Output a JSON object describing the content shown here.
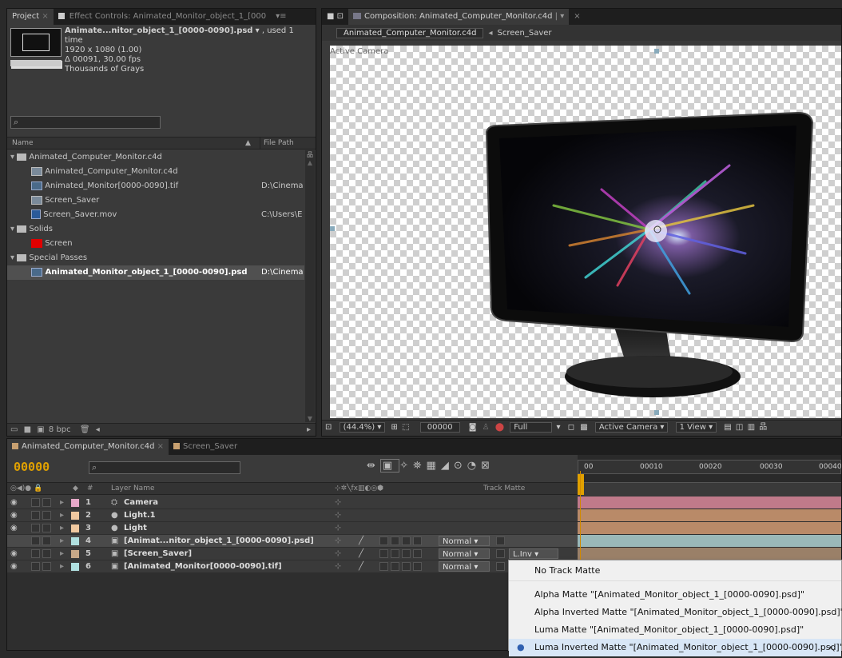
{
  "project_panel": {
    "tabs": [
      "Project",
      "Effect Controls: Animated_Monitor_object_1_[000",
      "▾≡"
    ],
    "footage": {
      "name": "Animate...nitor_object_1_[0000-0090].psd",
      "usage": ", used 1 time",
      "resolution": "1920 x 1080 (1.00)",
      "duration": "Δ 00091, 30.00 fps",
      "color": "Thousands of Grays"
    },
    "search_placeholder": "",
    "columns": {
      "name": "Name",
      "path": "File Path"
    },
    "items": [
      {
        "label": "Animated_Computer_Monitor.c4d",
        "path": "",
        "type": "folder",
        "indent": 0
      },
      {
        "label": "Animated_Computer_Monitor.c4d",
        "path": "",
        "type": "comp",
        "indent": 1
      },
      {
        "label": "Animated_Monitor[0000-0090].tif",
        "path": "D:\\Cinema",
        "type": "footage",
        "indent": 1
      },
      {
        "label": "Screen_Saver",
        "path": "",
        "type": "comp",
        "indent": 1
      },
      {
        "label": "Screen_Saver.mov",
        "path": "C:\\Users\\E",
        "type": "movie",
        "indent": 1
      },
      {
        "label": "Solids",
        "path": "",
        "type": "folder",
        "indent": 0
      },
      {
        "label": "Screen",
        "path": "",
        "type": "solid",
        "indent": 1
      },
      {
        "label": "Special Passes",
        "path": "",
        "type": "folder",
        "indent": 0
      },
      {
        "label": "Animated_Monitor_object_1_[0000-0090].psd",
        "path": "D:\\Cinema",
        "type": "footage",
        "indent": 1,
        "selected": true
      }
    ],
    "bpc": "8 bpc"
  },
  "composition_panel": {
    "tab": "Composition: Animated_Computer_Monitor.c4d",
    "breadcrumbs": [
      "Animated_Computer_Monitor.c4d",
      "Screen_Saver"
    ],
    "active_camera_label": "Active Camera",
    "toolbar": {
      "zoom": "(44.4%)",
      "timecode": "00000",
      "resolution": "Full",
      "camera": "Active Camera",
      "views": "1 View"
    }
  },
  "timeline": {
    "tabs": [
      "Animated_Computer_Monitor.c4d",
      "Screen_Saver"
    ],
    "timecode": "00000",
    "columns": {
      "layer_name": "Layer Name",
      "track_matte": "Track Matte",
      "num": "#"
    },
    "ruler": [
      "00010",
      "00020",
      "00030",
      "00040"
    ],
    "layers": [
      {
        "num": "1",
        "name": "Camera",
        "color": "#e6a8c8",
        "mode": "",
        "matte": "",
        "bar": "#c07a8a"
      },
      {
        "num": "2",
        "name": "Light.1",
        "color": "#f0c8a0",
        "mode": "",
        "matte": "",
        "bar": "#b98a68"
      },
      {
        "num": "3",
        "name": "Light",
        "color": "#f0c8a0",
        "mode": "",
        "matte": "",
        "bar": "#b98a68"
      },
      {
        "num": "4",
        "name": "[Animat...nitor_object_1_[0000-0090].psd]",
        "color": "#b0e0e0",
        "mode": "Normal",
        "matte": "",
        "bar": "#9ab8b8"
      },
      {
        "num": "5",
        "name": "[Screen_Saver]",
        "color": "#c8a888",
        "mode": "Normal",
        "matte": "L.Inv",
        "bar": "#9a8068"
      },
      {
        "num": "6",
        "name": "[Animated_Monitor[0000-0090].tif]",
        "color": "#b0e0e0",
        "mode": "Normal",
        "matte": "",
        "bar": "#6a8080"
      }
    ]
  },
  "track_matte_menu": {
    "items": [
      {
        "label": "No Track Matte",
        "checked": false
      },
      {
        "label": "Alpha Matte \"[Animated_Monitor_object_1_[0000-0090].psd]\"",
        "checked": false
      },
      {
        "label": "Alpha Inverted Matte \"[Animated_Monitor_object_1_[0000-0090].psd]\"",
        "checked": false
      },
      {
        "label": "Luma Matte \"[Animated_Monitor_object_1_[0000-0090].psd]\"",
        "checked": false
      },
      {
        "label": "Luma Inverted Matte \"[Animated_Monitor_object_1_[0000-0090].psd]\"",
        "checked": true
      }
    ]
  },
  "colors": {
    "accent_timecode": "#e0a000",
    "selection": "#4a4a4a",
    "playhead": "#d08a00"
  }
}
